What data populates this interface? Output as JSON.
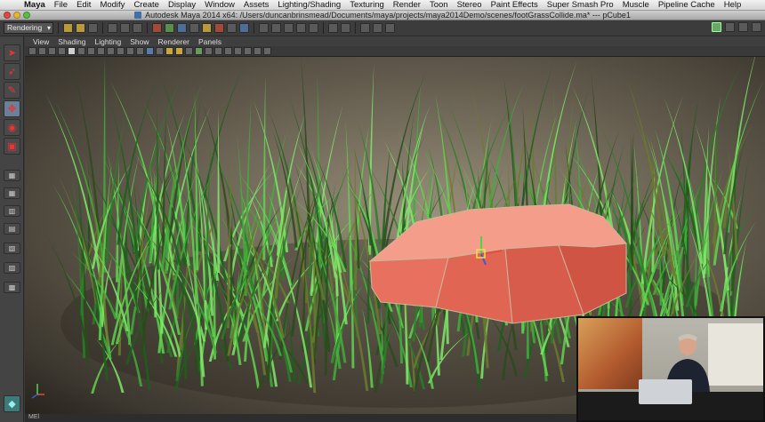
{
  "menubar": {
    "apple": "",
    "items": [
      "Maya",
      "File",
      "Edit",
      "Modify",
      "Create",
      "Display",
      "Window",
      "Assets",
      "Lighting/Shading",
      "Texturing",
      "Render",
      "Toon",
      "Stereo",
      "Paint Effects",
      "Super Smash Pro",
      "Muscle",
      "Pipeline Cache",
      "Help"
    ]
  },
  "window": {
    "title": "Autodesk Maya 2014 x64: /Users/duncanbrinsmead/Documents/maya/projects/maya2014Demo/scenes/footGrassCollide.ma*  ---  pCube1"
  },
  "statusline": {
    "mode": "Rendering"
  },
  "panel": {
    "menus": [
      "View",
      "Shading",
      "Lighting",
      "Show",
      "Renderer",
      "Panels"
    ]
  },
  "viewport": {
    "camera_label": "",
    "background": "#6e6656",
    "object_color": "#e8705e",
    "grass_color": "#3fae3a"
  },
  "bottom": {
    "mel_label": "MEl"
  }
}
